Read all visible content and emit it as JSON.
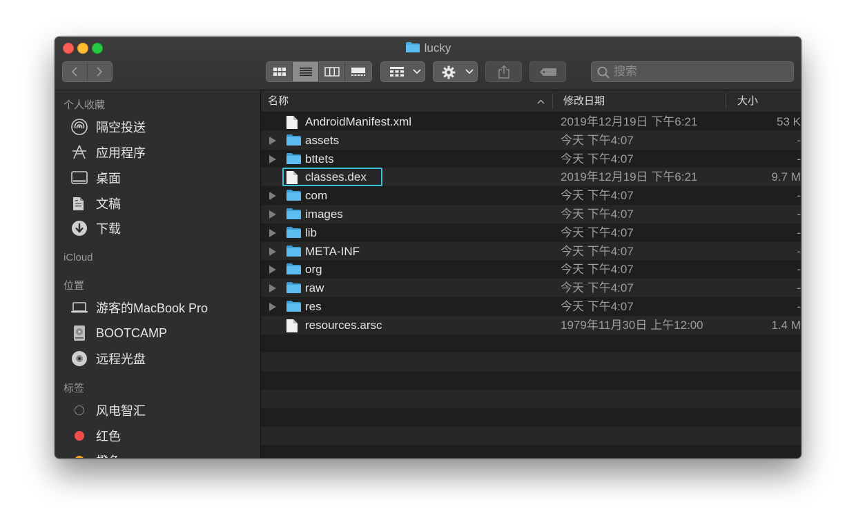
{
  "window": {
    "title": "lucky"
  },
  "toolbar": {
    "view_modes": [
      "icon-view",
      "list-view",
      "column-view",
      "gallery-view"
    ],
    "search_placeholder": "搜索"
  },
  "sidebar": {
    "favorites_header": "个人收藏",
    "favorites": [
      {
        "label": "隔空投送",
        "icon": "airdrop-icon"
      },
      {
        "label": "应用程序",
        "icon": "applications-icon"
      },
      {
        "label": "桌面",
        "icon": "desktop-icon"
      },
      {
        "label": "文稿",
        "icon": "documents-icon"
      },
      {
        "label": "下载",
        "icon": "downloads-icon"
      }
    ],
    "icloud_header": "iCloud",
    "locations_header": "位置",
    "locations": [
      {
        "label": "游客的MacBook Pro",
        "icon": "laptop-icon"
      },
      {
        "label": "BOOTCAMP",
        "icon": "disk-icon"
      },
      {
        "label": "远程光盘",
        "icon": "optical-disc-icon"
      }
    ],
    "tags_header": "标签",
    "tags": [
      {
        "label": "风电智汇",
        "color": "none"
      },
      {
        "label": "红色",
        "color": "#f44d4d"
      },
      {
        "label": "橙色",
        "color": "#f5a623"
      }
    ]
  },
  "columns": {
    "name": "名称",
    "date": "修改日期",
    "size": "大小"
  },
  "files": [
    {
      "name": "AndroidManifest.xml",
      "type": "file",
      "date": "2019年12月19日 下午6:21",
      "size": "53 K"
    },
    {
      "name": "assets",
      "type": "folder",
      "date": "今天 下午4:07",
      "size": "-"
    },
    {
      "name": "bttets",
      "type": "folder",
      "date": "今天 下午4:07",
      "size": "-"
    },
    {
      "name": "classes.dex",
      "type": "file",
      "date": "2019年12月19日 下午6:21",
      "size": "9.7 M",
      "selected": true
    },
    {
      "name": "com",
      "type": "folder",
      "date": "今天 下午4:07",
      "size": "-"
    },
    {
      "name": "images",
      "type": "folder",
      "date": "今天 下午4:07",
      "size": "-"
    },
    {
      "name": "lib",
      "type": "folder",
      "date": "今天 下午4:07",
      "size": "-"
    },
    {
      "name": "META-INF",
      "type": "folder",
      "date": "今天 下午4:07",
      "size": "-"
    },
    {
      "name": "org",
      "type": "folder",
      "date": "今天 下午4:07",
      "size": "-"
    },
    {
      "name": "raw",
      "type": "folder",
      "date": "今天 下午4:07",
      "size": "-"
    },
    {
      "name": "res",
      "type": "folder",
      "date": "今天 下午4:07",
      "size": "-"
    },
    {
      "name": "resources.arsc",
      "type": "file",
      "date": "1979年11月30日 上午12:00",
      "size": "1.4 M"
    }
  ]
}
